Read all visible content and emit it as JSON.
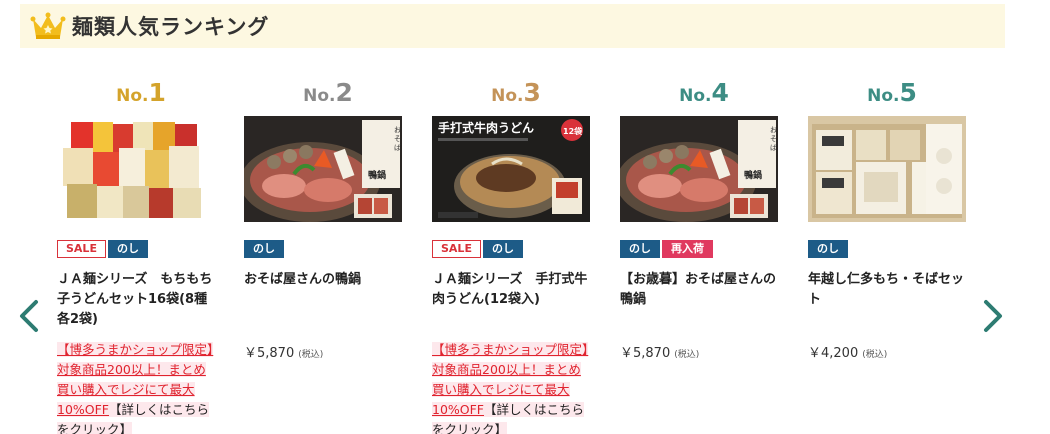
{
  "header": {
    "title": "麺類人気ランキング",
    "icon": "crown-icon",
    "bg_color": "#fdf8e1"
  },
  "nav": {
    "prev_icon": "chevron-left-icon",
    "next_icon": "chevron-right-icon",
    "arrow_color": "#2d7c72"
  },
  "rank_prefix": "No.",
  "items": [
    {
      "rank": "1",
      "badges": [
        "SALE",
        "のし"
      ],
      "name": "ＪＡ麺シリーズ　もちもち子うどんセット16袋(8種各2袋)",
      "price": "",
      "tax": "",
      "promo": {
        "highlight": "【博多うまかショップ限定】対象商品200以上！まとめ買い購入でレジにて最大10%OFF",
        "tail": "【詳しくはこちらをクリック】"
      }
    },
    {
      "rank": "2",
      "badges": [
        "のし"
      ],
      "name": "おそば屋さんの鴨鍋",
      "price": "￥5,870",
      "tax": "(税込)"
    },
    {
      "rank": "3",
      "badges": [
        "SALE",
        "のし"
      ],
      "name": "ＪＡ麺シリーズ　手打式牛肉うどん(12袋入)",
      "price": "",
      "tax": "",
      "image_text": {
        "title": "手打式牛肉うどん",
        "count": "12袋"
      },
      "promo": {
        "highlight": "【博多うまかショップ限定】対象商品200以上！まとめ買い購入でレジにて最大10%OFF",
        "tail": "【詳しくはこちらをクリック】"
      }
    },
    {
      "rank": "4",
      "badges": [
        "のし",
        "再入荷"
      ],
      "name": "【お歳暮】おそば屋さんの鴨鍋",
      "price": "￥5,870",
      "tax": "(税込)"
    },
    {
      "rank": "5",
      "badges": [
        "のし"
      ],
      "name": "年越し仁多もち・そばセット",
      "price": "￥4,200",
      "tax": "(税込)"
    }
  ]
}
